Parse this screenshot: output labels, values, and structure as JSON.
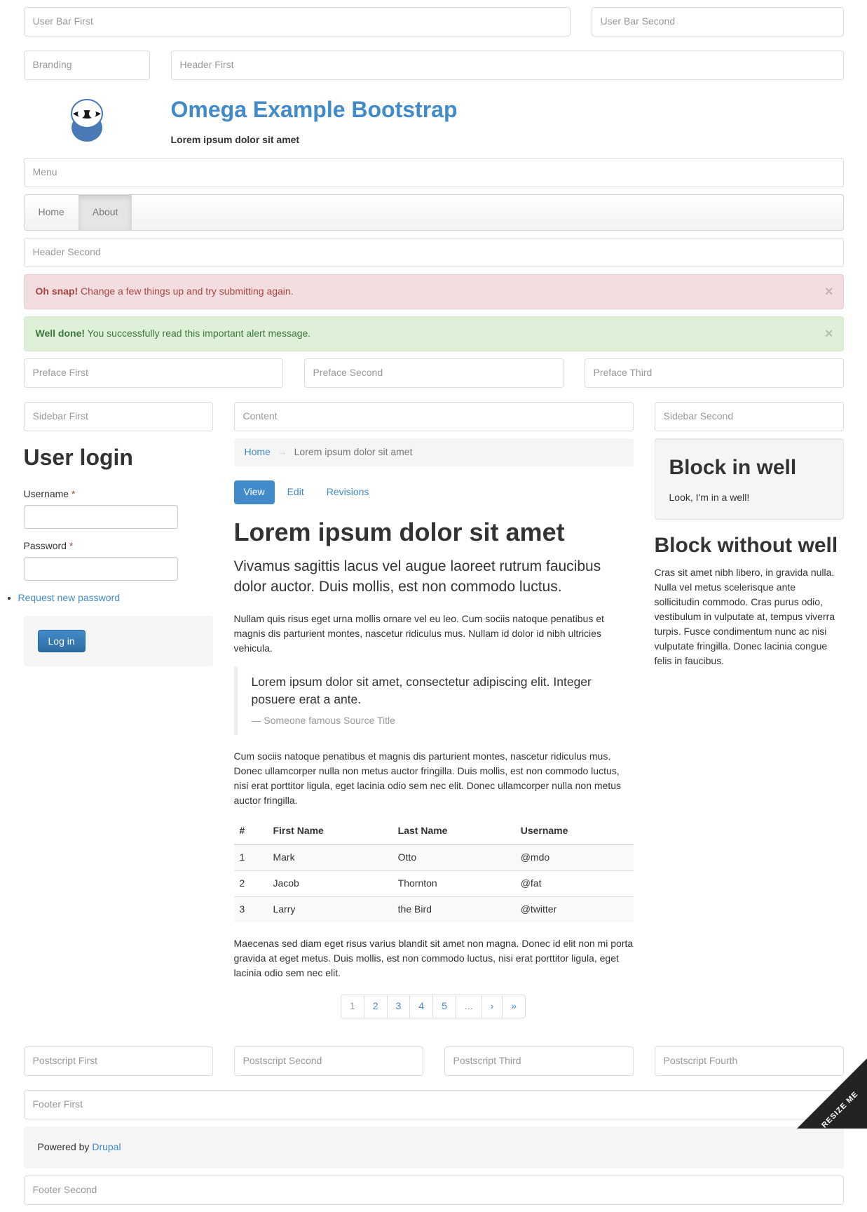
{
  "regions": {
    "user_bar_first": "User Bar First",
    "user_bar_second": "User Bar Second",
    "branding": "Branding",
    "header_first": "Header First",
    "menu": "Menu",
    "header_second": "Header Second",
    "preface_first": "Preface First",
    "preface_second": "Preface Second",
    "preface_third": "Preface Third",
    "sidebar_first": "Sidebar First",
    "content": "Content",
    "sidebar_second": "Sidebar Second",
    "postscript_first": "Postscript First",
    "postscript_second": "Postscript Second",
    "postscript_third": "Postscript Third",
    "postscript_fourth": "Postscript Fourth",
    "footer_first": "Footer First",
    "footer_second": "Footer Second"
  },
  "site": {
    "name": "Omega Example Bootstrap",
    "slogan": "Lorem ipsum dolor sit amet"
  },
  "nav": {
    "home": "Home",
    "about": "About"
  },
  "alerts": {
    "error_strong": "Oh snap!",
    "error_text": " Change a few things up and try submitting again.",
    "success_strong": "Well done!",
    "success_text": " You successfully read this important alert message."
  },
  "login": {
    "title": "User login",
    "username": "Username",
    "password": "Password",
    "request": "Request new password",
    "submit": "Log in"
  },
  "breadcrumb": {
    "home": "Home",
    "current": "Lorem ipsum dolor sit amet"
  },
  "tabs": {
    "view": "View",
    "edit": "Edit",
    "revisions": "Revisions"
  },
  "article": {
    "title": "Lorem ipsum dolor sit amet",
    "lead": "Vivamus sagittis lacus vel augue laoreet rutrum faucibus dolor auctor. Duis mollis, est non commodo luctus.",
    "p1": "Nullam quis risus eget urna mollis ornare vel eu leo. Cum sociis natoque penatibus et magnis dis parturient montes, nascetur ridiculus mus. Nullam id dolor id nibh ultricies vehicula.",
    "quote": "Lorem ipsum dolor sit amet, consectetur adipiscing elit. Integer posuere erat a ante.",
    "quote_footer": "Someone famous Source Title",
    "p2": "Cum sociis natoque penatibus et magnis dis parturient montes, nascetur ridiculus mus. Donec ullamcorper nulla non metus auctor fringilla. Duis mollis, est non commodo luctus, nisi erat porttitor ligula, eget lacinia odio sem nec elit. Donec ullamcorper nulla non metus auctor fringilla.",
    "p3": "Maecenas sed diam eget risus varius blandit sit amet non magna. Donec id elit non mi porta gravida at eget metus. Duis mollis, est non commodo luctus, nisi erat porttitor ligula, eget lacinia odio sem nec elit."
  },
  "table": {
    "headers": {
      "num": "#",
      "first": "First Name",
      "last": "Last Name",
      "user": "Username"
    },
    "rows": [
      {
        "num": "1",
        "first": "Mark",
        "last": "Otto",
        "user": "@mdo"
      },
      {
        "num": "2",
        "first": "Jacob",
        "last": "Thornton",
        "user": "@fat"
      },
      {
        "num": "3",
        "first": "Larry",
        "last": "the Bird",
        "user": "@twitter"
      }
    ]
  },
  "pagination": {
    "p1": "1",
    "p2": "2",
    "p3": "3",
    "p4": "4",
    "p5": "5",
    "dots": "...",
    "next": "›",
    "last": "»"
  },
  "well_block": {
    "title": "Block in well",
    "text": "Look, I'm in a well!"
  },
  "plain_block": {
    "title": "Block without well",
    "text": "Cras sit amet nibh libero, in gravida nulla. Nulla vel metus scelerisque ante sollicitudin commodo. Cras purus odio, vestibulum in vulputate at, tempus viverra turpis. Fusce condimentum nunc ac nisi vulputate fringilla. Donec lacinia congue felis in faucibus."
  },
  "footer": {
    "powered_prefix": "Powered by ",
    "powered_link": "Drupal"
  },
  "resize": "RESIZE ME"
}
